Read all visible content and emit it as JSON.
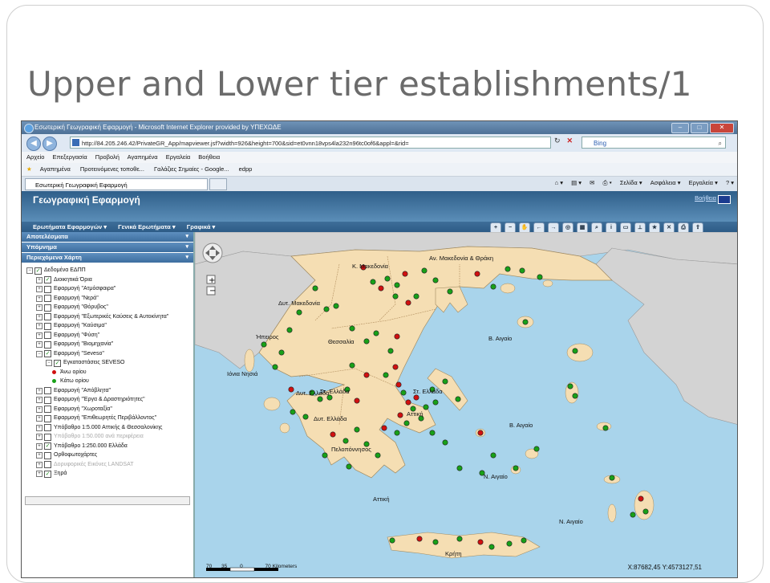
{
  "slide": {
    "title": "Upper and Lower tier establishments/1"
  },
  "browser": {
    "window_title": "Εσωτερική Γεωγραφική Εφαρμογή - Microsoft Internet Explorer provided by ΥΠΕΧΩΔΕ",
    "url": "http://84.205.246.42/PrivateGR_App/mapviewer.jsf?width=926&height=700&sid=et0vnn18vps4la232n96tc0of6&appl=&rid=",
    "search_engine": "Bing",
    "menu": [
      "Αρχείο",
      "Επεξεργασία",
      "Προβολή",
      "Αγαπημένα",
      "Εργαλεία",
      "Βοήθεια"
    ],
    "favorites": [
      "Αγαπημένα",
      "Προτεινόμενες τοποθε...",
      "Γαλάζιες Σημαίες - Google...",
      "edpp"
    ],
    "tab_label": "Εσωτερική Γεωγραφική Εφαρμογή",
    "command_bar": [
      "Σελίδα ▾",
      "Ασφάλεια ▾",
      "Εργαλεία ▾"
    ]
  },
  "app": {
    "title": "Γεωγραφική Εφαρμογή",
    "help": "Βοήθεια",
    "menus": [
      "Ερωτήματα Εφαρμογών ▾",
      "Γενικά Ερωτήματα ▾",
      "Γραφικά ▾"
    ],
    "tool_icons": [
      "zoom-in",
      "zoom-out",
      "pan",
      "back",
      "forward",
      "identify",
      "layers",
      "find",
      "info",
      "select",
      "measure",
      "favorite",
      "clear",
      "print",
      "export"
    ]
  },
  "panels": {
    "results": "Αποτελέσματα",
    "legend": "Υπόμνημα",
    "contents": "Περιεχόμενα Χάρτη"
  },
  "tree": [
    {
      "label": "Δεδομένα ΕΔΠΠ",
      "level": 0,
      "checked": true,
      "expander": "−"
    },
    {
      "label": "Διοικητικά Όρια",
      "level": 1,
      "checked": true,
      "expander": "+"
    },
    {
      "label": "Εφαρμογή \"Ατμόσφαιρα\"",
      "level": 1,
      "checked": false,
      "expander": "+"
    },
    {
      "label": "Εφαρμογή \"Νερά\"",
      "level": 1,
      "checked": false,
      "expander": "+"
    },
    {
      "label": "Εφαρμογή \"Θόρυβος\"",
      "level": 1,
      "checked": false,
      "expander": "+"
    },
    {
      "label": "Εφαρμογή \"Εξωτερικές Καύσεις & Αυτοκίνητα\"",
      "level": 1,
      "checked": false,
      "expander": "+"
    },
    {
      "label": "Εφαρμογή \"Καύσιμα\"",
      "level": 1,
      "checked": false,
      "expander": "+"
    },
    {
      "label": "Εφαρμογή \"Φύση\"",
      "level": 1,
      "checked": false,
      "expander": "+"
    },
    {
      "label": "Εφαρμογή \"Βιομηχανία\"",
      "level": 1,
      "checked": false,
      "expander": "+"
    },
    {
      "label": "Εφαρμογή \"Seveso\"",
      "level": 1,
      "checked": true,
      "expander": "−"
    },
    {
      "label": "Εγκαταστάσεις SEVESO",
      "level": 2,
      "checked": true,
      "expander": "−"
    },
    {
      "label": "Άνω ορίου",
      "level": 3,
      "dot": "#d01010"
    },
    {
      "label": "Κάτω ορίου",
      "level": 3,
      "dot": "#18a018"
    },
    {
      "label": "Εφαρμογή \"Απόβλητα\"",
      "level": 1,
      "checked": false,
      "expander": "+"
    },
    {
      "label": "Εφαρμογή \"Έργα & Δραστηριότητες\"",
      "level": 1,
      "checked": false,
      "expander": "+"
    },
    {
      "label": "Εφαρμογή \"Χωροταξία\"",
      "level": 1,
      "checked": false,
      "expander": "+"
    },
    {
      "label": "Εφαρμογή \"Επιθεωρητές Περιβάλλοντος\"",
      "level": 1,
      "checked": false,
      "expander": "+"
    },
    {
      "label": "Υπόβαθρο 1:5.000 Αττικής & Θεσσαλονίκης",
      "level": 1,
      "checked": false,
      "expander": "+"
    },
    {
      "label": "Υπόβαθρο 1:50.000 ανά περιφέρεια",
      "level": 1,
      "checked": false,
      "expander": "+",
      "disabled": true
    },
    {
      "label": "Υπόβαθρο 1:250.000 Ελλάδα",
      "level": 1,
      "checked": true,
      "expander": "+"
    },
    {
      "label": "Ορθοφωτοχάρτες",
      "level": 1,
      "checked": false,
      "expander": "+"
    },
    {
      "label": "Δορυφορικές Εικόνες LANDSAT",
      "level": 1,
      "checked": false,
      "expander": "+",
      "disabled": true
    },
    {
      "label": "Ξηρά",
      "level": 1,
      "checked": true,
      "expander": "+"
    }
  ],
  "map": {
    "labels": [
      {
        "text": "Κ. Μακεδονία",
        "key": "kmak"
      },
      {
        "text": "Αν. Μακεδονία & Θράκη",
        "key": "amth"
      },
      {
        "text": "Δυτ. Μακεδονία",
        "key": "dmak"
      },
      {
        "text": "Ήπειρος",
        "key": "ipeiros"
      },
      {
        "text": "Θεσσαλία",
        "key": "thess"
      },
      {
        "text": "Β. Αιγαίο",
        "key": "baig1"
      },
      {
        "text": "Ιόνια Νησιά",
        "key": "ionia"
      },
      {
        "text": "Στ. Ελλάδα",
        "key": "stel1"
      },
      {
        "text": "Στ. Ελλάδα",
        "key": "stel2"
      },
      {
        "text": "Δυτ. Ελλάδα",
        "key": "dytel1"
      },
      {
        "text": "Δυτ. Ελλάδα",
        "key": "dytel2"
      },
      {
        "text": "Αττική",
        "key": "attiki1"
      },
      {
        "text": "Β. Αιγαίο",
        "key": "baig2"
      },
      {
        "text": "Πελοπόννησος",
        "key": "pelop"
      },
      {
        "text": "Ν. Αιγαίο",
        "key": "naig1"
      },
      {
        "text": "Αττική",
        "key": "attiki2"
      },
      {
        "text": "Ν. Αιγαίο",
        "key": "naig2"
      },
      {
        "text": "Κρήτη",
        "key": "kriti"
      }
    ],
    "scale_ticks": [
      "70",
      "35",
      "0",
      "70 Kilometers"
    ],
    "coordinates": "X:87682,45 Y:4573127,51"
  },
  "colors": {
    "land": "#f5deb3",
    "neighbor": "#d3d3d3",
    "sea": "#a9d4eb",
    "upper_tier": "#d01010",
    "lower_tier": "#18a018"
  }
}
